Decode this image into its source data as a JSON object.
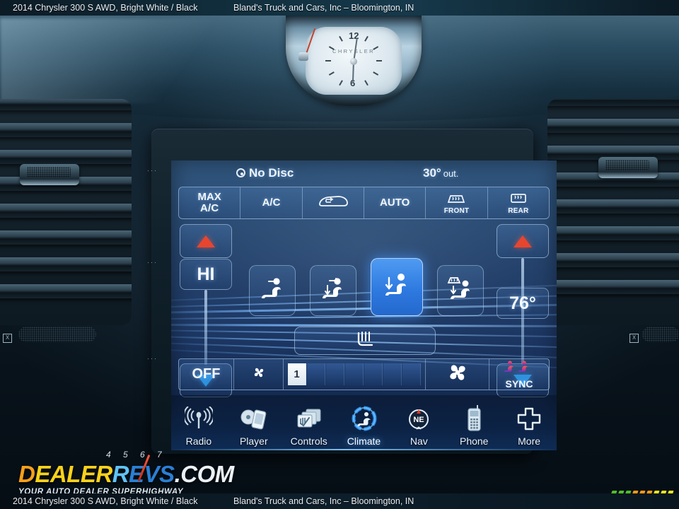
{
  "caption": {
    "vehicle": "2014 Chrysler 300 S AWD,  Bright White / Black",
    "dealer": "Bland's Truck and Cars, Inc – Bloomington, IN"
  },
  "clock": {
    "brand": "CHRYSLER",
    "num_12": "12",
    "num_6": "6"
  },
  "screen": {
    "status": {
      "disc_icon": "disc-icon",
      "disc_text": "No Disc",
      "outside_temp": "30°",
      "outside_unit": "out."
    },
    "mode_buttons": [
      {
        "label": "MAX",
        "sub": "A/C",
        "icon": "",
        "name": "max-ac"
      },
      {
        "label": "A/C",
        "sub": "",
        "icon": "",
        "name": "ac"
      },
      {
        "label": "",
        "sub": "",
        "icon": "recirculate-car-icon",
        "name": "recirculate"
      },
      {
        "label": "AUTO",
        "sub": "",
        "icon": "",
        "name": "auto"
      },
      {
        "label": "",
        "sub": "FRONT",
        "icon": "front-defrost-icon",
        "name": "front-defrost"
      },
      {
        "label": "",
        "sub": "REAR",
        "icon": "rear-defrost-icon",
        "name": "rear-defrost"
      }
    ],
    "temp_left": {
      "up_icon": "triangle-up-icon",
      "value": "HI",
      "down_icon": "triangle-down-icon"
    },
    "temp_right": {
      "up_icon": "triangle-up-icon",
      "value": "76°",
      "down_icon": "triangle-down-icon"
    },
    "airflow_modes": [
      {
        "name": "airflow-face",
        "icon": "seat-face-vent-icon",
        "selected": false
      },
      {
        "name": "airflow-face-floor",
        "icon": "seat-face-floor-vent-icon",
        "selected": false
      },
      {
        "name": "airflow-floor",
        "icon": "seat-floor-vent-icon",
        "selected": true
      },
      {
        "name": "airflow-floor-defrost",
        "icon": "seat-floor-defrost-icon",
        "selected": false
      }
    ],
    "heated_seat": {
      "name": "heated-seat-button",
      "icon": "heated-seat-icon"
    },
    "fan": {
      "off_label": "OFF",
      "min_icon": "fan-small-icon",
      "max_icon": "fan-large-icon",
      "level": 1,
      "segments": 7,
      "sync_label": "SYNC",
      "sync_icon": "sync-seats-icon"
    },
    "nav": [
      {
        "label": "Radio",
        "icon": "radio-antenna-icon",
        "active": false
      },
      {
        "label": "Player",
        "icon": "disc-phone-icon",
        "active": false
      },
      {
        "label": "Controls",
        "icon": "cards-stack-icon",
        "active": false
      },
      {
        "label": "Climate",
        "icon": "climate-seat-icon",
        "active": true
      },
      {
        "label": "Nav",
        "icon": "compass-ne-icon",
        "active": false
      },
      {
        "label": "Phone",
        "icon": "mobile-phone-icon",
        "active": false
      },
      {
        "label": "More",
        "icon": "plus-icon",
        "active": false
      }
    ]
  },
  "watermark": {
    "part_dealer_d": "D",
    "part_dealer_rest": "EALER",
    "part_revs_r": "R",
    "part_revs_rest": "EVS",
    "part_dotcom": ".COM",
    "tagline": "YOUR AUTO DEALER SUPERHIGHWAY",
    "gauge_numbers": "4 5 6 7"
  },
  "colors": {
    "accent_blue": "#2e7ae0",
    "warm_red": "#e8452f",
    "cool_blue": "#2ea0f0",
    "bar_green": "#4fbf2a",
    "bar_orange": "#f59a17",
    "bar_yellow": "#e8e320"
  }
}
